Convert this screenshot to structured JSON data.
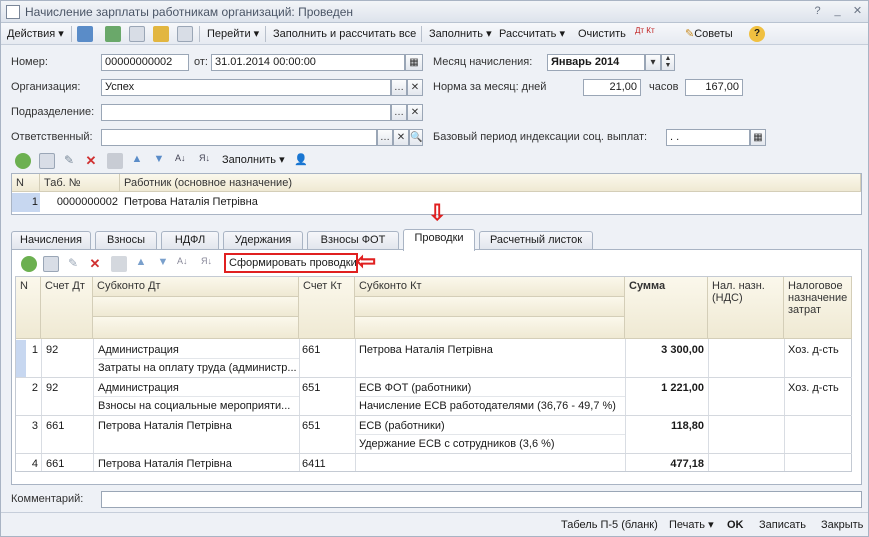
{
  "window": {
    "title": "Начисление зарплаты работникам организаций: Проведен"
  },
  "toolbar": {
    "actions": "Действия",
    "goto": "Перейти",
    "fill_and_calc": "Заполнить и рассчитать все",
    "fill": "Заполнить",
    "calculate": "Рассчитать",
    "clear": "Очистить",
    "dtkt": "Дт Кт",
    "tips": "Советы"
  },
  "form": {
    "number_label": "Номер:",
    "number_value": "00000000002",
    "date_label": "от:",
    "date_value": "31.01.2014 00:00:00",
    "org_label": "Организация:",
    "org_value": "Успех",
    "dept_label": "Подразделение:",
    "dept_value": "",
    "resp_label": "Ответственный:",
    "resp_value": "",
    "month_label": "Месяц начисления:",
    "month_value": "Январь 2014",
    "norm_label": "Норма за месяц: дней",
    "norm_days": "21,00",
    "hours_label": "часов",
    "norm_hours": "167,00",
    "base_label": "Базовый период индексации соц. выплат:",
    "base_value": " .  ."
  },
  "emp_toolbar": {
    "fill": "Заполнить"
  },
  "emp_grid": {
    "headers": [
      "N",
      "Таб. №",
      "Работник (основное назначение)"
    ],
    "rows": [
      {
        "n": "1",
        "tab": "0000000002",
        "name": "Петрова Наталія Петрівна"
      }
    ]
  },
  "tabs": [
    "Начисления",
    "Взносы",
    "НДФЛ",
    "Удержания",
    "Взносы ФОТ",
    "Проводки",
    "Расчетный листок"
  ],
  "post_toolbar": {
    "generate": "Сформировать проводки"
  },
  "post_grid": {
    "headers": {
      "n": "N",
      "dt": "Счет Дт",
      "sub_dt": "Субконто Дт",
      "kt": "Счет Кт",
      "sub_kt": "Субконто Кт",
      "sum": "Сумма",
      "vat": "Нал. назн. (НДС)",
      "tax": "Налоговое назначение затрат"
    },
    "rows": [
      {
        "n": "1",
        "dt": "92",
        "sub_dt1": "Администрация",
        "sub_dt2": "Затраты на оплату труда (администр...",
        "kt": "661",
        "sub_kt1": "Петрова Наталія Петрівна",
        "sub_kt2": "",
        "sum": "3 300,00",
        "vat": "",
        "tax": "Хоз. д-сть"
      },
      {
        "n": "2",
        "dt": "92",
        "sub_dt1": "Администрация",
        "sub_dt2": "Взносы на социальные мероприяти...",
        "kt": "651",
        "sub_kt1": "ЕСВ ФОТ (работники)",
        "sub_kt2": "Начисление ЕСВ работодателями (36,76 - 49,7 %)",
        "sum": "1 221,00",
        "vat": "",
        "tax": "Хоз. д-сть"
      },
      {
        "n": "3",
        "dt": "661",
        "sub_dt1": "Петрова Наталія Петрівна",
        "sub_dt2": "",
        "kt": "651",
        "sub_kt1": "ЕСВ (работники)",
        "sub_kt2": "Удержание ЕСВ с сотрудников (3,6 %)",
        "sum": "118,80",
        "vat": "",
        "tax": ""
      },
      {
        "n": "4",
        "dt": "661",
        "sub_dt1": "Петрова Наталія Петрівна",
        "sub_dt2": "",
        "kt": "6411",
        "sub_kt1": "",
        "sub_kt2": "",
        "sum": "477,18",
        "vat": "",
        "tax": ""
      }
    ]
  },
  "comment": {
    "label": "Комментарий:",
    "value": ""
  },
  "footer": {
    "tab5": "Табель П-5 (бланк)",
    "print": "Печать",
    "ok": "OK",
    "save": "Записать",
    "close": "Закрыть"
  },
  "colors": {
    "selection": "#c7d7f0",
    "header_bg": "#f3eedb",
    "arrow": "#e02020"
  }
}
